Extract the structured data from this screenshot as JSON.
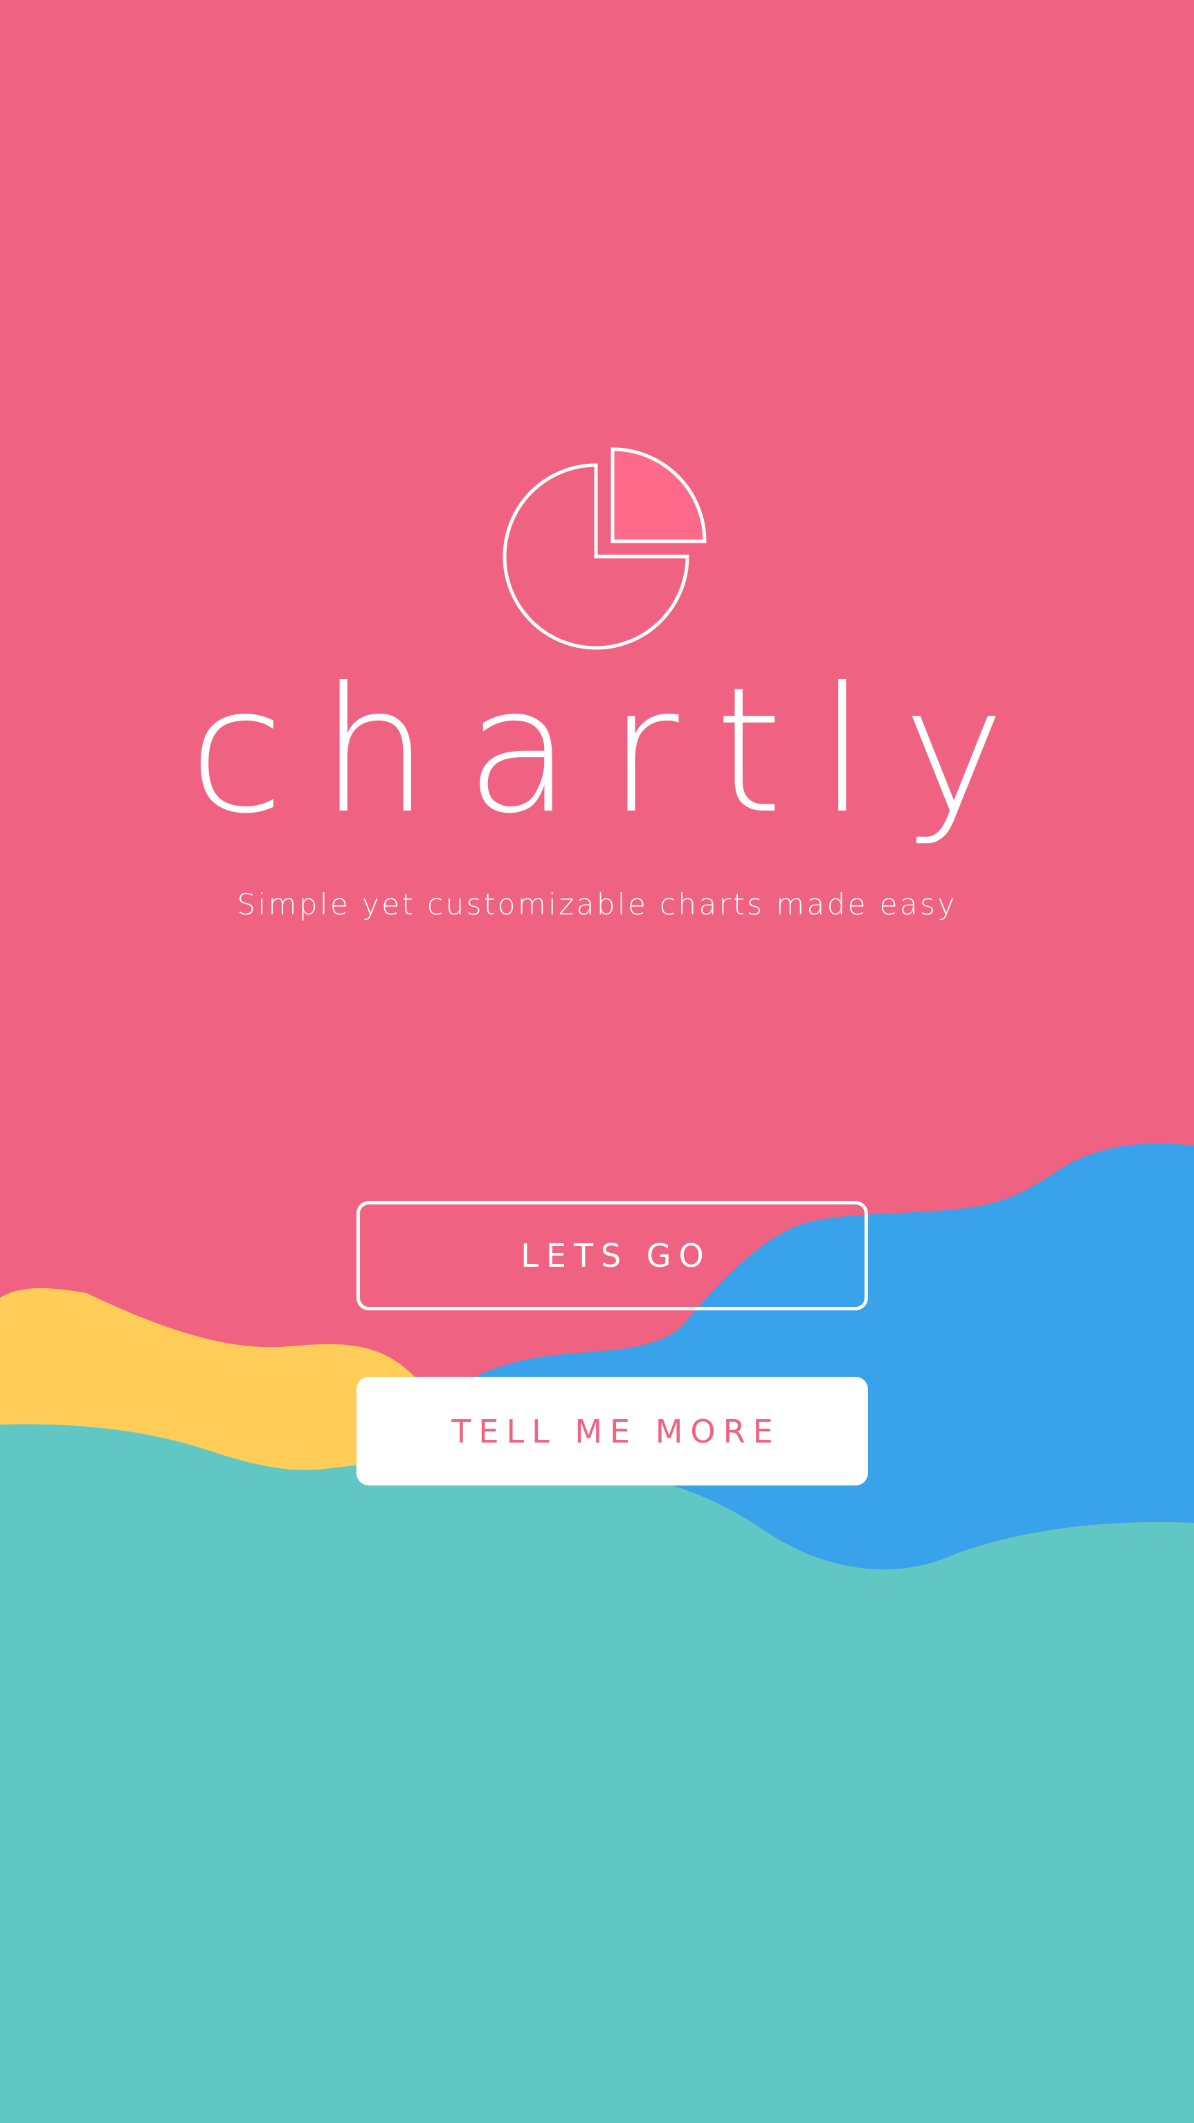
{
  "app": {
    "name": "chartly",
    "tagline": "Simple yet customizable charts made easy",
    "logo_icon": "pie-chart-icon"
  },
  "actions": {
    "primary_label": "LETS GO",
    "secondary_label": "TELL ME MORE"
  },
  "colors": {
    "background": "#ef6282",
    "slice": "#ff6a8a",
    "wave_yellow": "#ffcd58",
    "wave_blue": "#38a2ea",
    "wave_teal": "#61c7c5",
    "text": "#ffffff"
  }
}
